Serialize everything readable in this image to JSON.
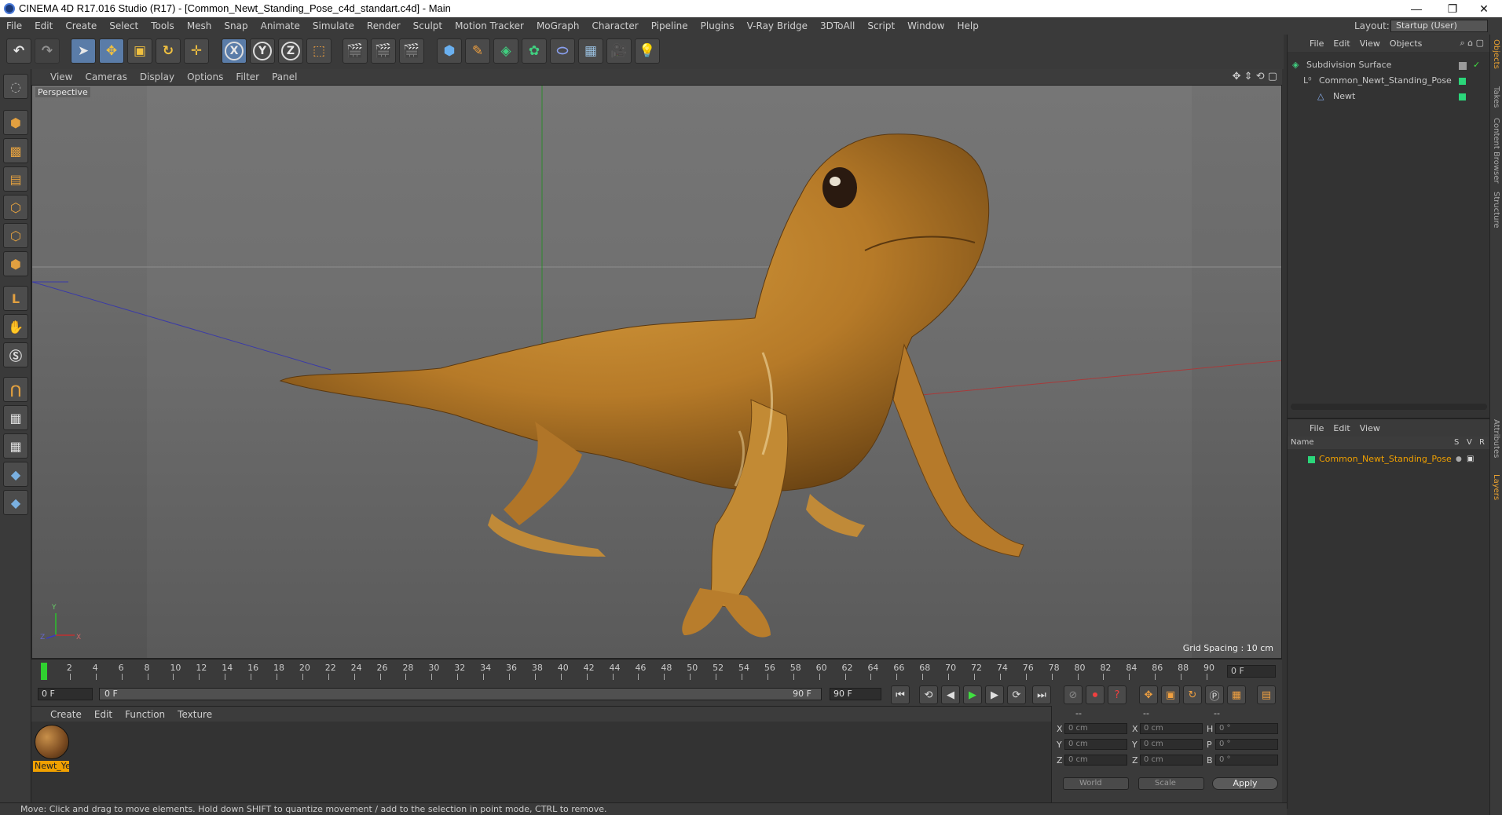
{
  "window": {
    "title": "CINEMA 4D R17.016 Studio (R17) - [Common_Newt_Standing_Pose_c4d_standart.c4d] - Main",
    "minimize": "—",
    "restore": "❐",
    "close": "✕"
  },
  "menu": [
    "File",
    "Edit",
    "Create",
    "Select",
    "Tools",
    "Mesh",
    "Snap",
    "Animate",
    "Simulate",
    "Render",
    "Sculpt",
    "Motion Tracker",
    "MoGraph",
    "Character",
    "Pipeline",
    "Plugins",
    "V-Ray Bridge",
    "3DToAll",
    "Script",
    "Window",
    "Help"
  ],
  "layout": {
    "label": "Layout:",
    "value": "Startup (User)"
  },
  "viewport": {
    "menu": [
      "View",
      "Cameras",
      "Display",
      "Options",
      "Filter",
      "Panel"
    ],
    "label": "Perspective",
    "grid_spacing": "Grid Spacing : 10 cm",
    "axis_y": "Y",
    "axis_z": "Z",
    "axis_x": "X"
  },
  "timeline": {
    "ticks": [
      "0",
      "2",
      "4",
      "6",
      "8",
      "10",
      "12",
      "14",
      "16",
      "18",
      "20",
      "22",
      "24",
      "26",
      "28",
      "30",
      "32",
      "34",
      "36",
      "38",
      "40",
      "42",
      "44",
      "46",
      "48",
      "50",
      "52",
      "54",
      "56",
      "58",
      "60",
      "62",
      "64",
      "66",
      "68",
      "70",
      "72",
      "74",
      "76",
      "78",
      "80",
      "82",
      "84",
      "86",
      "88",
      "90"
    ],
    "current_frame": "0 F"
  },
  "transport": {
    "start": "0 F",
    "range_start": "0 F",
    "range_end": "90 F",
    "end": "90 F"
  },
  "material": {
    "menu": [
      "Create",
      "Edit",
      "Function",
      "Texture"
    ],
    "name": "Newt_Ye"
  },
  "coords": {
    "pos": [
      {
        "axis": "X",
        "value": "0 cm"
      },
      {
        "axis": "Y",
        "value": "0 cm"
      },
      {
        "axis": "Z",
        "value": "0 cm"
      }
    ],
    "size": [
      {
        "axis": "X",
        "value": "0 cm"
      },
      {
        "axis": "Y",
        "value": "0 cm"
      },
      {
        "axis": "Z",
        "value": "0 cm"
      }
    ],
    "rot": [
      {
        "axis": "H",
        "value": "0 °"
      },
      {
        "axis": "P",
        "value": "0 °"
      },
      {
        "axis": "B",
        "value": "0 °"
      }
    ],
    "space": "World",
    "mode": "Scale",
    "apply": "Apply",
    "head1": "--",
    "head2": "--",
    "head3": "--"
  },
  "status": "Move: Click and drag to move elements. Hold down SHIFT to quantize movement / add to the selection in point mode, CTRL to remove.",
  "objects": {
    "menu": [
      "File",
      "Edit",
      "View",
      "Objects"
    ],
    "items": [
      {
        "name": "Subdivision Surface",
        "indent": 0
      },
      {
        "name": "Common_Newt_Standing_Pose",
        "indent": 1
      },
      {
        "name": "Newt",
        "indent": 2
      }
    ]
  },
  "layers": {
    "menu": [
      "File",
      "Edit",
      "View"
    ],
    "head_name": "Name",
    "head_s": "S",
    "head_v": "V",
    "head_r": "R",
    "items": [
      {
        "name": "Common_Newt_Standing_Pose"
      }
    ]
  },
  "righttabs": [
    "Objects",
    "Takes",
    "Content Browser",
    "Structure",
    "Attributes",
    "Layers"
  ],
  "colors": {
    "accent": "#f0a000",
    "green": "#2bd67a",
    "highlight": "#5a7ca8"
  }
}
